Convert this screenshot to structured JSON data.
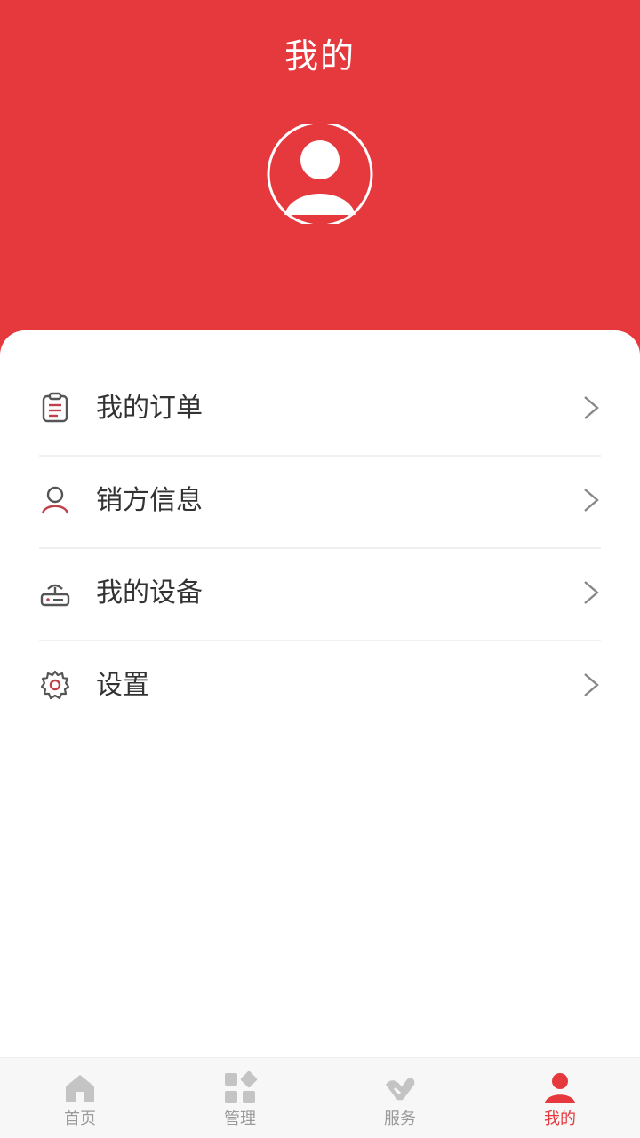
{
  "header": {
    "title": "我的"
  },
  "menu": {
    "items": [
      {
        "label": "我的订单",
        "icon": "clipboard-icon"
      },
      {
        "label": "销方信息",
        "icon": "user-outline-icon"
      },
      {
        "label": "我的设备",
        "icon": "router-icon"
      },
      {
        "label": "设置",
        "icon": "gear-icon"
      }
    ]
  },
  "tabbar": {
    "tabs": [
      {
        "label": "首页",
        "icon": "home-icon",
        "active": false
      },
      {
        "label": "管理",
        "icon": "grid-icon",
        "active": false
      },
      {
        "label": "服务",
        "icon": "handshake-icon",
        "active": false
      },
      {
        "label": "我的",
        "icon": "person-icon",
        "active": true
      }
    ]
  },
  "colors": {
    "accent": "#e5393e",
    "text": "#333333",
    "muted": "#9a9a9a",
    "divider": "#f0f0f0"
  }
}
